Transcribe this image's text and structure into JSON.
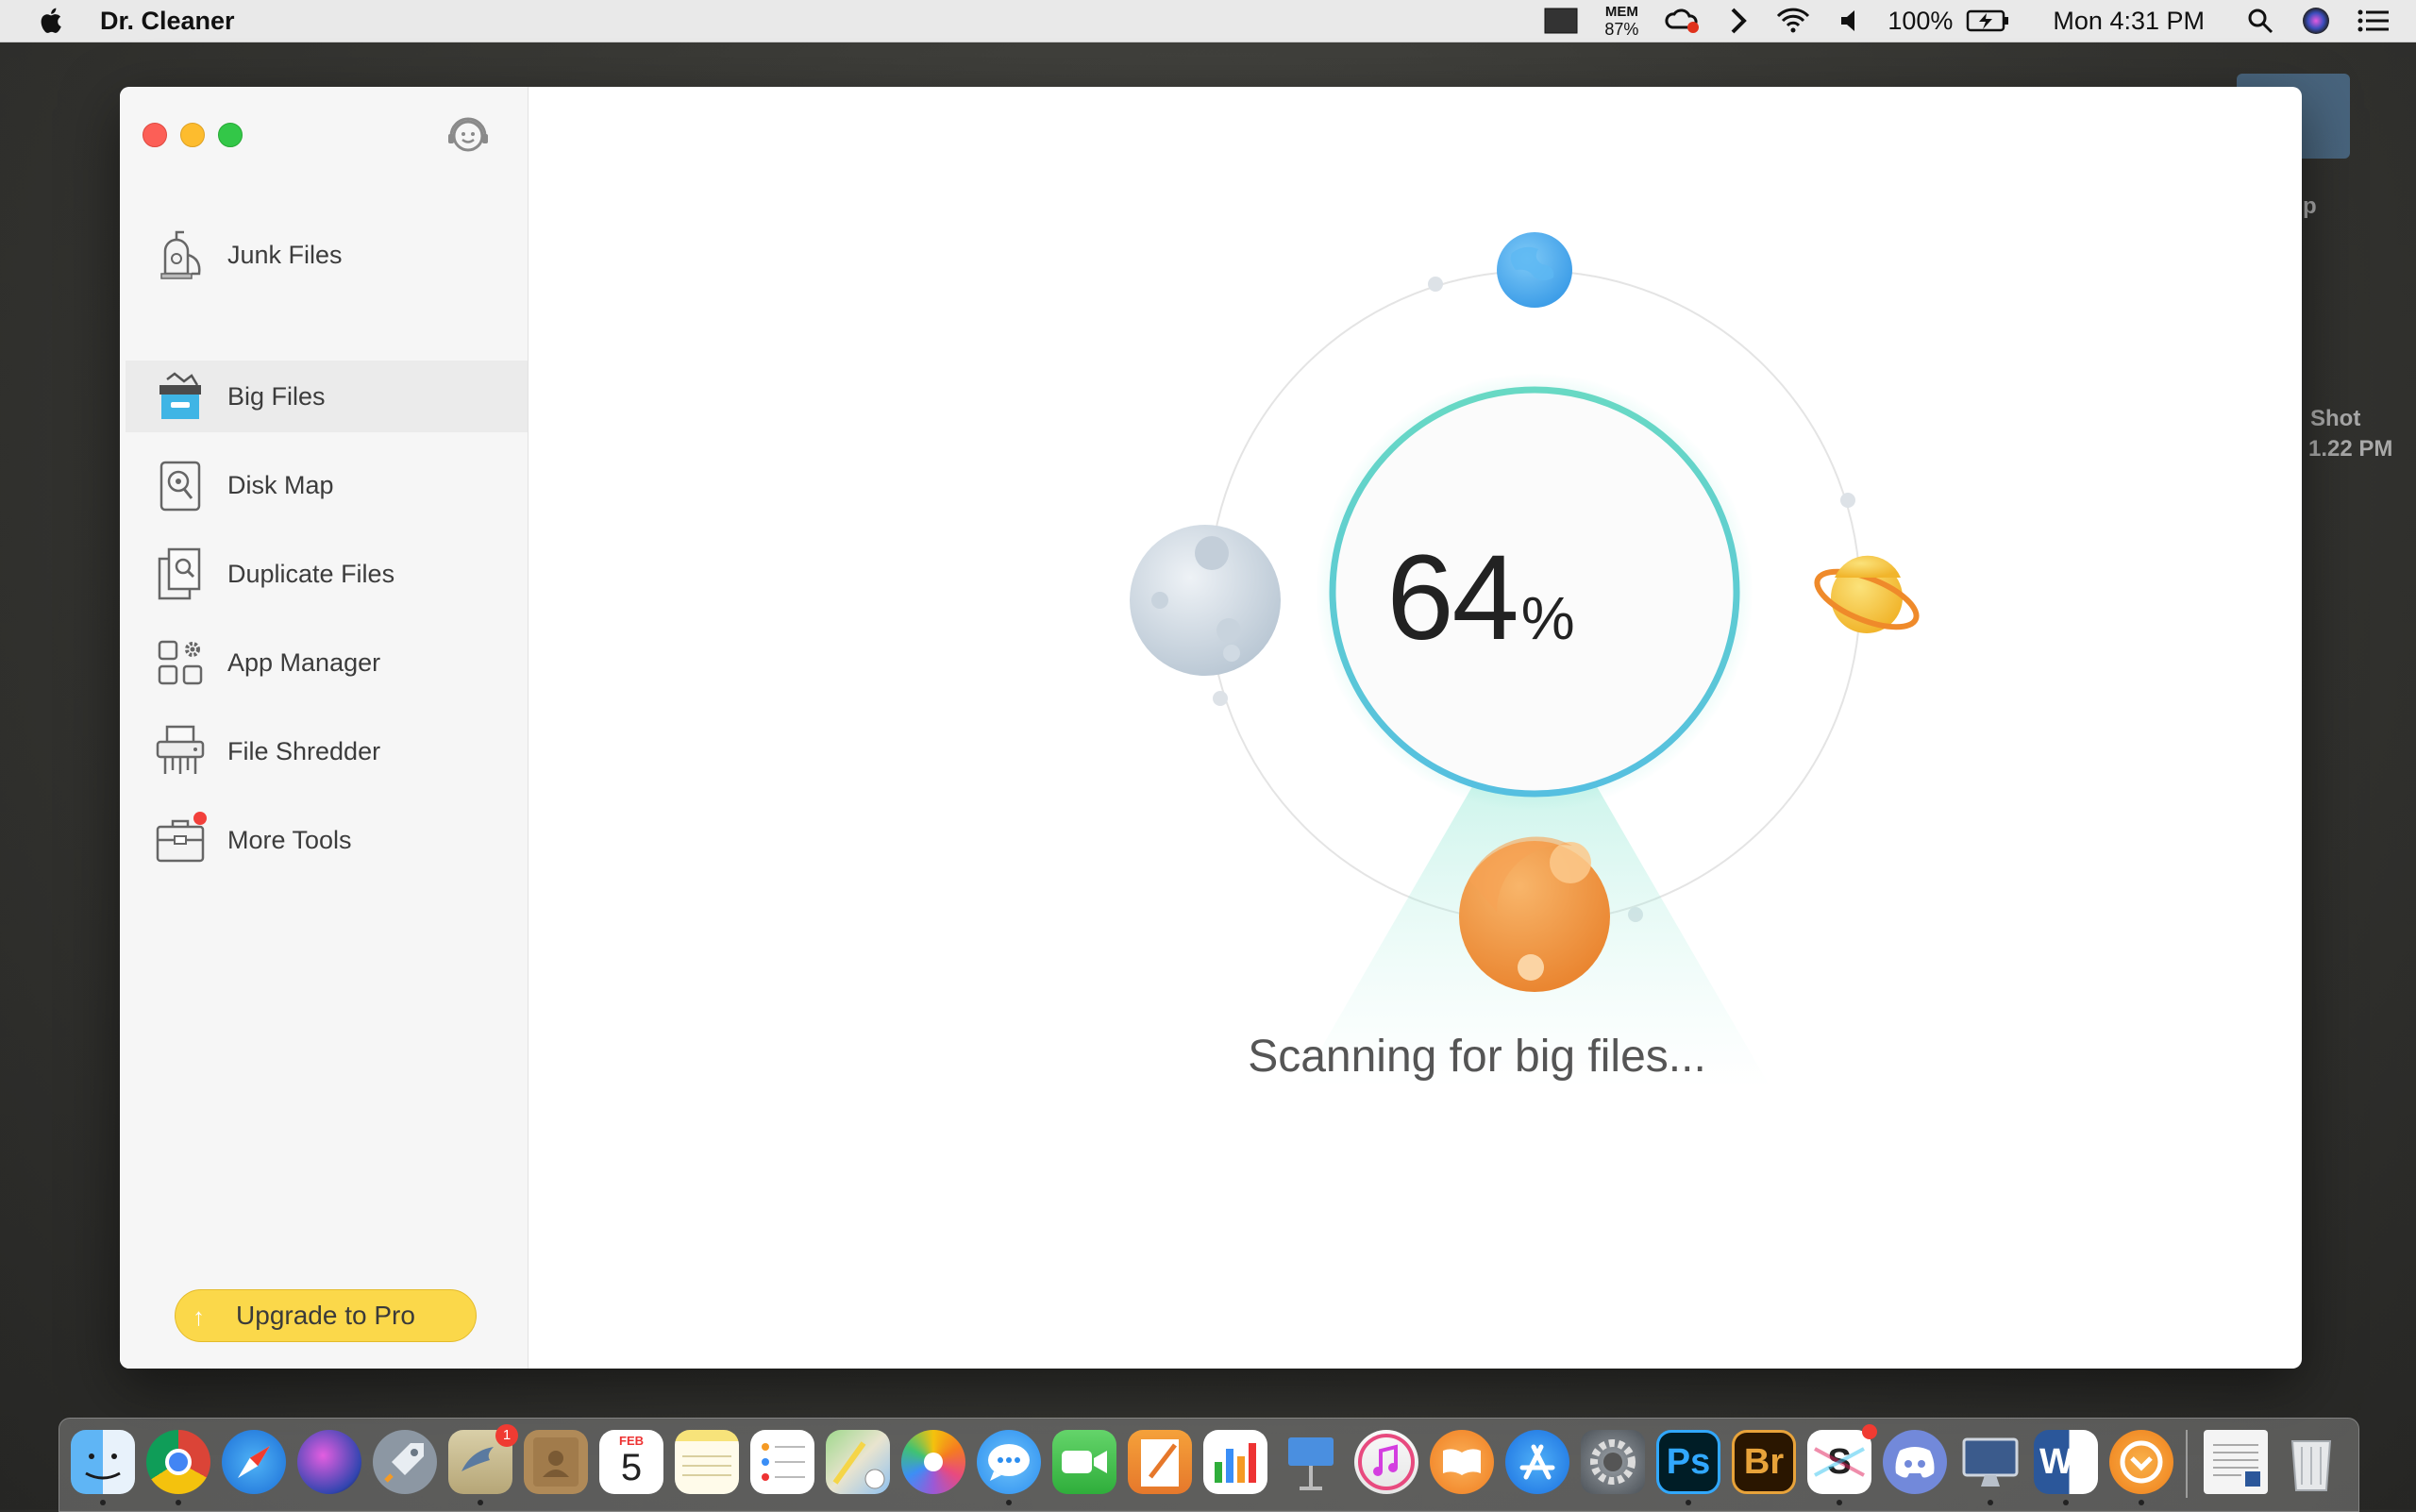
{
  "menubar": {
    "app_name": "Dr. Cleaner",
    "mem_label": "MEM",
    "mem_value": "87%",
    "battery": "100%",
    "clock": "Mon 4:31 PM"
  },
  "desktop": {
    "label_fragment": "p",
    "screenshot_line1": "Shot",
    "screenshot_line2": "1.22 PM"
  },
  "sidebar": {
    "items": [
      {
        "label": "Junk Files",
        "icon": "vacuum-icon"
      },
      {
        "label": "Big Files",
        "icon": "big-files-box-icon"
      },
      {
        "label": "Disk Map",
        "icon": "disk-map-icon"
      },
      {
        "label": "Duplicate Files",
        "icon": "duplicate-files-icon"
      },
      {
        "label": "App Manager",
        "icon": "app-manager-icon"
      },
      {
        "label": "File Shredder",
        "icon": "shredder-icon"
      },
      {
        "label": "More Tools",
        "icon": "toolbox-icon"
      }
    ],
    "active_index": 1,
    "upgrade_label": "Upgrade to Pro"
  },
  "scan": {
    "percent": "64",
    "percent_sign": "%",
    "progress": 0.64,
    "status": "Scanning for big files..."
  },
  "dock": {
    "calendar_month": "FEB",
    "calendar_day": "5",
    "mail_badge": "1",
    "ps_label": "Ps",
    "br_label": "Br",
    "word_label": "W",
    "s_label": "S"
  },
  "colors": {
    "ring_teal": "#5fd4c4",
    "upgrade_yellow": "#fbd84a",
    "planet_blue": "#5ab4f0",
    "planet_orange": "#f09a3e",
    "planet_yellow": "#f7c83a"
  }
}
